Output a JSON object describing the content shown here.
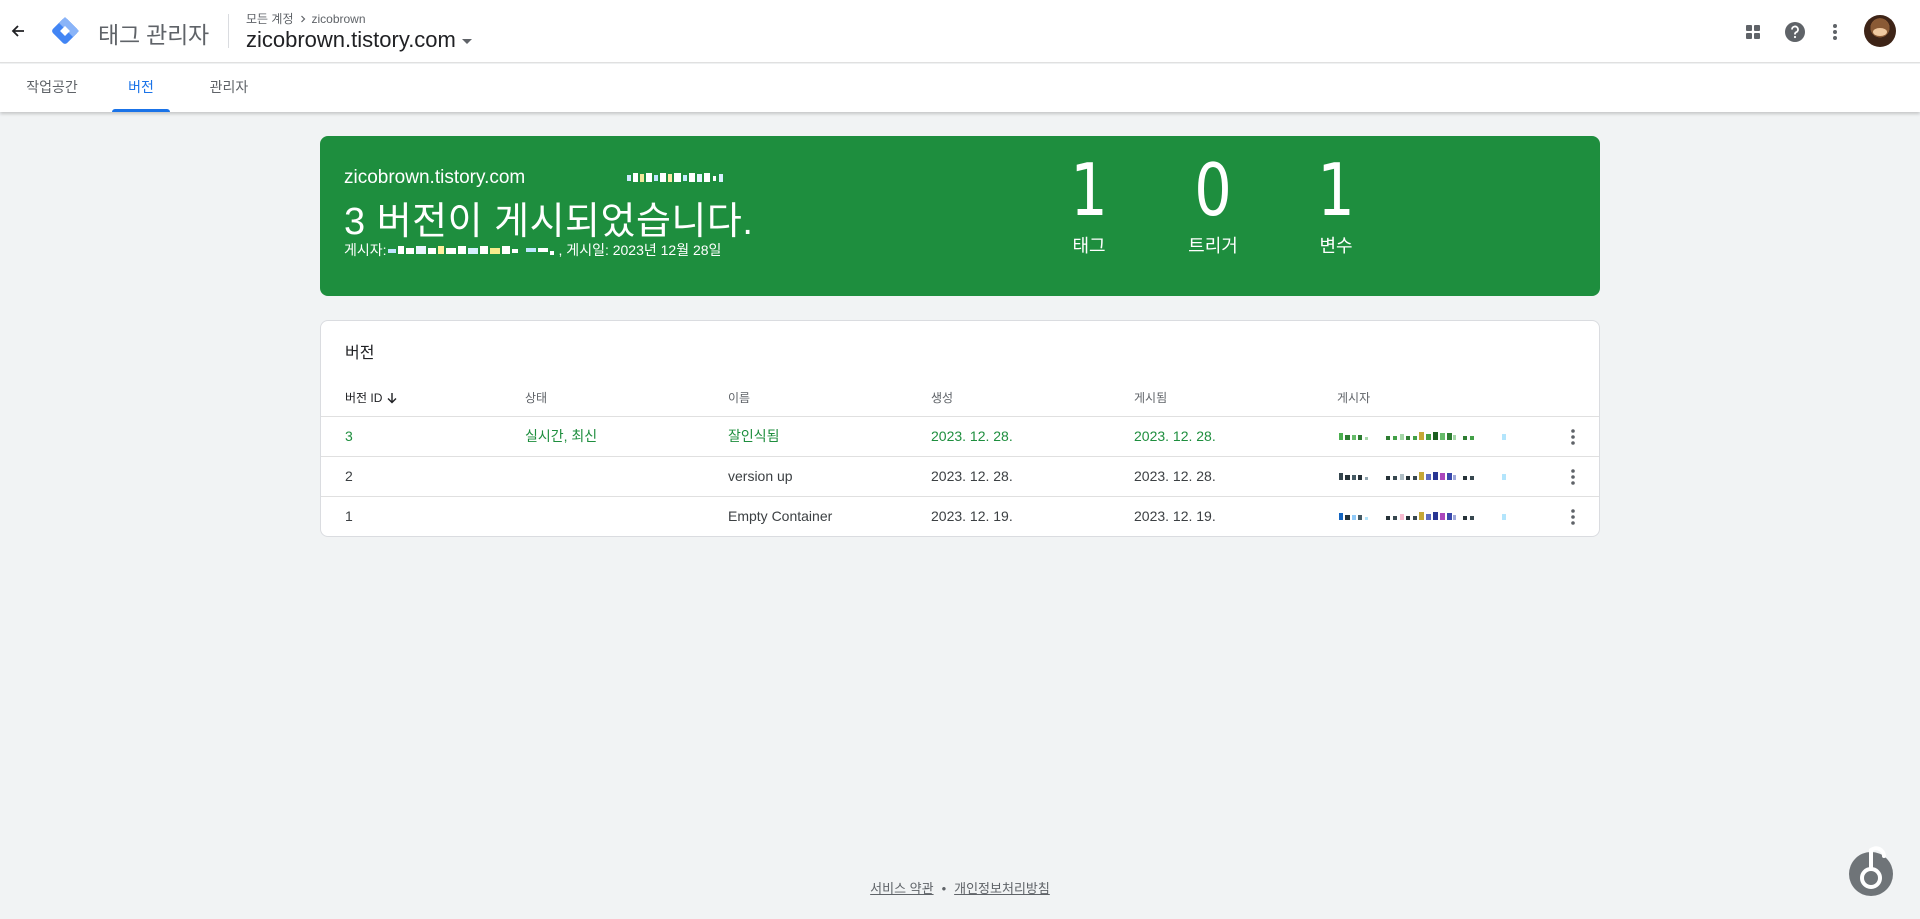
{
  "header": {
    "app_title": "태그 관리자",
    "breadcrumb": {
      "all_accounts": "모든 계정",
      "account": "zicobrown"
    },
    "container": "zicobrown.tistory.com"
  },
  "tabs": [
    {
      "label": "작업공간"
    },
    {
      "label": "버전"
    },
    {
      "label": "관리자"
    }
  ],
  "banner": {
    "container": "zicobrown.tistory.com",
    "title": "3 버전이 게시되었습니다.",
    "publisher_label": "게시자:",
    "published_label": ", 게시일: 2023년 12월 28일",
    "stats": [
      {
        "value": "1",
        "label": "태그"
      },
      {
        "value": "0",
        "label": "트리거"
      },
      {
        "value": "1",
        "label": "변수"
      }
    ],
    "background_color": "#1e8e3e"
  },
  "versions": {
    "title": "버전",
    "columns": [
      "버전 ID",
      "상태",
      "이름",
      "생성",
      "게시됨",
      "게시자"
    ],
    "rows": [
      {
        "id": "3",
        "status": "실시간, 최신",
        "name": "잘인식됨",
        "created": "2023. 12. 28.",
        "published": "2023. 12. 28."
      },
      {
        "id": "2",
        "status": "",
        "name": "version up",
        "created": "2023. 12. 28.",
        "published": "2023. 12. 28."
      },
      {
        "id": "1",
        "status": "",
        "name": "Empty Container",
        "created": "2023. 12. 19.",
        "published": "2023. 12. 19."
      }
    ]
  },
  "footer": {
    "terms": "서비스 약관",
    "separator": "•",
    "privacy": "개인정보처리방침"
  },
  "icons": {
    "back": "arrow-left-icon",
    "apps": "apps-grid-icon",
    "help": "help-icon",
    "more": "more-vert-icon",
    "sort": "arrow-down-icon"
  },
  "colors": {
    "accent": "#1a73e8",
    "live": "#1e8e3e"
  }
}
